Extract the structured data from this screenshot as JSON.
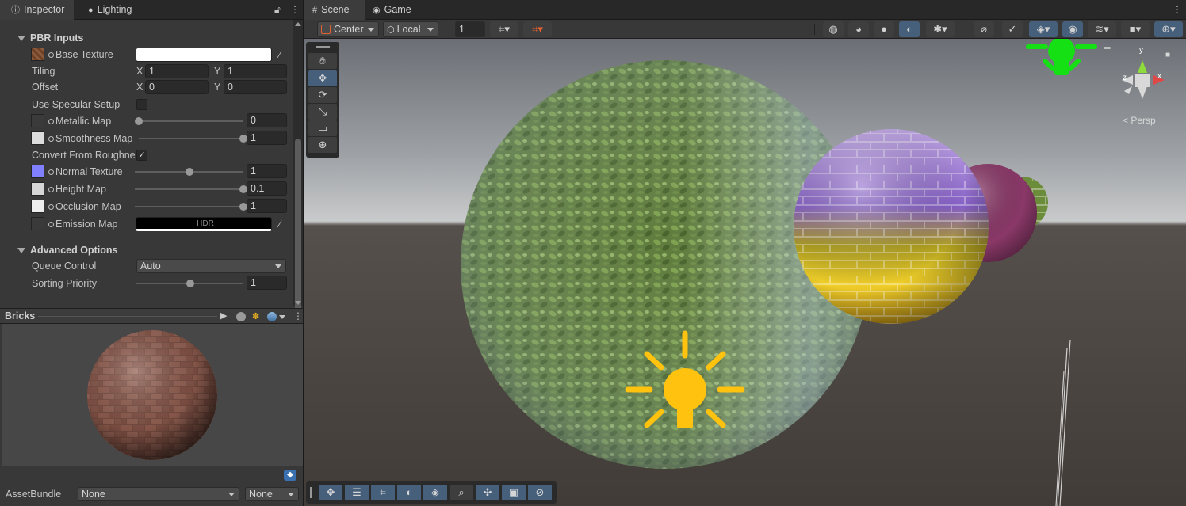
{
  "inspector": {
    "tabs": [
      {
        "label": "Inspector",
        "icon": "info-icon"
      },
      {
        "label": "Lighting",
        "icon": "lightbulb-icon"
      }
    ],
    "sections": {
      "pbr": "PBR Inputs",
      "advanced": "Advanced Options"
    },
    "base_texture": {
      "label": "Base Texture"
    },
    "tiling": {
      "label": "Tiling",
      "x_label": "X",
      "x": "1",
      "y_label": "Y",
      "y": "1"
    },
    "offset": {
      "label": "Offset",
      "x_label": "X",
      "x": "0",
      "y_label": "Y",
      "y": "0"
    },
    "use_specular": {
      "label": "Use Specular Setup",
      "checked": false
    },
    "metallic": {
      "label": "Metallic Map",
      "value": "0",
      "level": 0
    },
    "smoothness": {
      "label": "Smoothness Map",
      "value": "1",
      "level": 1
    },
    "convert_roughness": {
      "label": "Convert From Roughne",
      "checked": true,
      "check": "✓"
    },
    "normal": {
      "label": "Normal Texture",
      "value": "1",
      "level": 0.5
    },
    "height": {
      "label": "Height Map",
      "value": "0.1",
      "level": 1
    },
    "occlusion": {
      "label": "Occlusion Map",
      "value": "1",
      "level": 1
    },
    "emission": {
      "label": "Emission Map",
      "hdr": "HDR"
    },
    "queue_control": {
      "label": "Queue Control",
      "value": "Auto"
    },
    "sorting_priority": {
      "label": "Sorting Priority",
      "value": "1",
      "level": 0.5
    }
  },
  "preview": {
    "title": "Bricks"
  },
  "assetbundle": {
    "label": "AssetBundle",
    "name": "None",
    "variant": "None"
  },
  "scene": {
    "tabs": [
      {
        "label": "Scene",
        "icon": "grid-icon"
      },
      {
        "label": "Game",
        "icon": "gamepad-icon"
      }
    ],
    "pivot": "Center",
    "space": "Local",
    "snap_value": "1",
    "persp_label": "Persp",
    "gizmo_axes": {
      "x": "x",
      "y": "y",
      "z": "z"
    }
  },
  "colors": {
    "accent": "#46607c",
    "sun_light": "#ffc20e",
    "directional_light": "#14e014"
  }
}
